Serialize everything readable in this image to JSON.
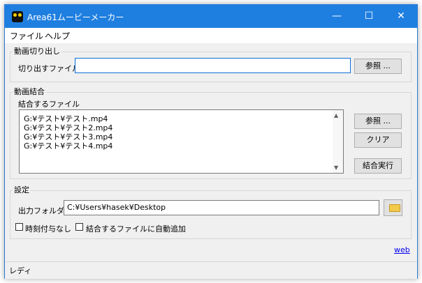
{
  "window": {
    "title": "Area61ムービーメーカー",
    "controls": {
      "minimize": "—",
      "maximize": "☐",
      "close": "✕"
    },
    "accent_color": "#1f7fe0"
  },
  "menu": [
    "ファイル",
    "ヘルプ"
  ],
  "extract": {
    "group_title": "動画切り出し",
    "field_label": "切り出すファイル",
    "value": "",
    "browse_label": "参照 ..."
  },
  "combine": {
    "group_title": "動画結合",
    "list_label": "結合するファイル",
    "files": [
      "G:¥テスト¥テスト.mp4",
      "G:¥テスト¥テスト2.mp4",
      "G:¥テスト¥テスト3.mp4",
      "G:¥テスト¥テスト4.mp4"
    ],
    "browse_label": "参照 ...",
    "clear_label": "クリア",
    "run_label": "結合実行"
  },
  "settings": {
    "group_title": "設定",
    "output_label": "出力フォルダ",
    "output_value": "C:¥Users¥hasek¥Desktop",
    "checkbox_no_timestamp": "時刻付与なし",
    "checkbox_auto_add": "結合するファイルに自動追加"
  },
  "web_link": "web",
  "status": "レディ"
}
